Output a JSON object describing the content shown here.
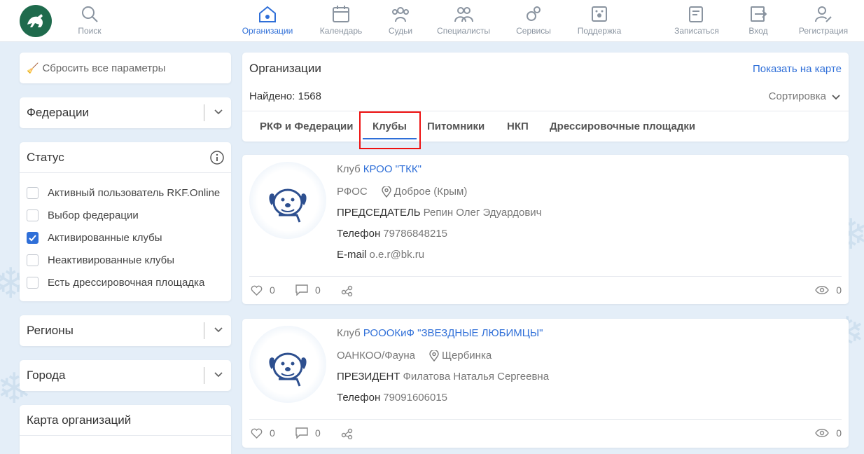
{
  "nav": {
    "items": [
      {
        "label": "Поиск"
      },
      {
        "label": "Организации"
      },
      {
        "label": "Календарь"
      },
      {
        "label": "Судьи"
      },
      {
        "label": "Специалисты"
      },
      {
        "label": "Сервисы"
      },
      {
        "label": "Поддержка"
      },
      {
        "label": "Записаться"
      },
      {
        "label": "Вход"
      },
      {
        "label": "Регистрация"
      }
    ]
  },
  "sidebar": {
    "reset_label": "Сбросить все параметры",
    "federations_label": "Федерации",
    "status": {
      "title": "Статус",
      "options": [
        {
          "label": "Активный пользователь RKF.Online",
          "checked": false
        },
        {
          "label": "Выбор федерации",
          "checked": false
        },
        {
          "label": "Активированные клубы",
          "checked": true
        },
        {
          "label": "Неактивированные клубы",
          "checked": false
        },
        {
          "label": "Есть дрессировочная площадка",
          "checked": false
        }
      ]
    },
    "regions_label": "Регионы",
    "cities_label": "Города",
    "map_label": "Карта организаций"
  },
  "main": {
    "title": "Организации",
    "show_on_map": "Показать на карте",
    "found": "Найдено: 1568",
    "sort_label": "Сортировка",
    "tabs": [
      {
        "label": "РКФ и Федерации"
      },
      {
        "label": "Клубы"
      },
      {
        "label": "Питомники"
      },
      {
        "label": "НКП"
      },
      {
        "label": "Дрессировочные площадки"
      }
    ]
  },
  "orgs": [
    {
      "type": "Клуб",
      "name": "КРОО \"ТКК\"",
      "federation": "РФОС",
      "city": "Доброе (Крым)",
      "role": "ПРЕДСЕДАТЕЛЬ",
      "person": "Репин Олег Эдуардович",
      "phone_label": "Телефон",
      "phone": "79786848215",
      "email_label": "E-mail",
      "email": "o.e.r@bk.ru",
      "likes": "0",
      "comments": "0",
      "views": "0"
    },
    {
      "type": "Клуб",
      "name": "РОООКиФ \"ЗВЕЗДНЫЕ ЛЮБИМЦЫ\"",
      "federation": "ОАНКОО/Фауна",
      "city": "Щербинка",
      "role": "ПРЕЗИДЕНТ",
      "person": "Филатова Наталья Сергеевна",
      "phone_label": "Телефон",
      "phone": "79091606015",
      "likes": "0",
      "comments": "0",
      "views": "0"
    }
  ],
  "colors": {
    "accent": "#2f6fd8",
    "logo": "#1f6b4d",
    "highlight": "#ee1111"
  }
}
